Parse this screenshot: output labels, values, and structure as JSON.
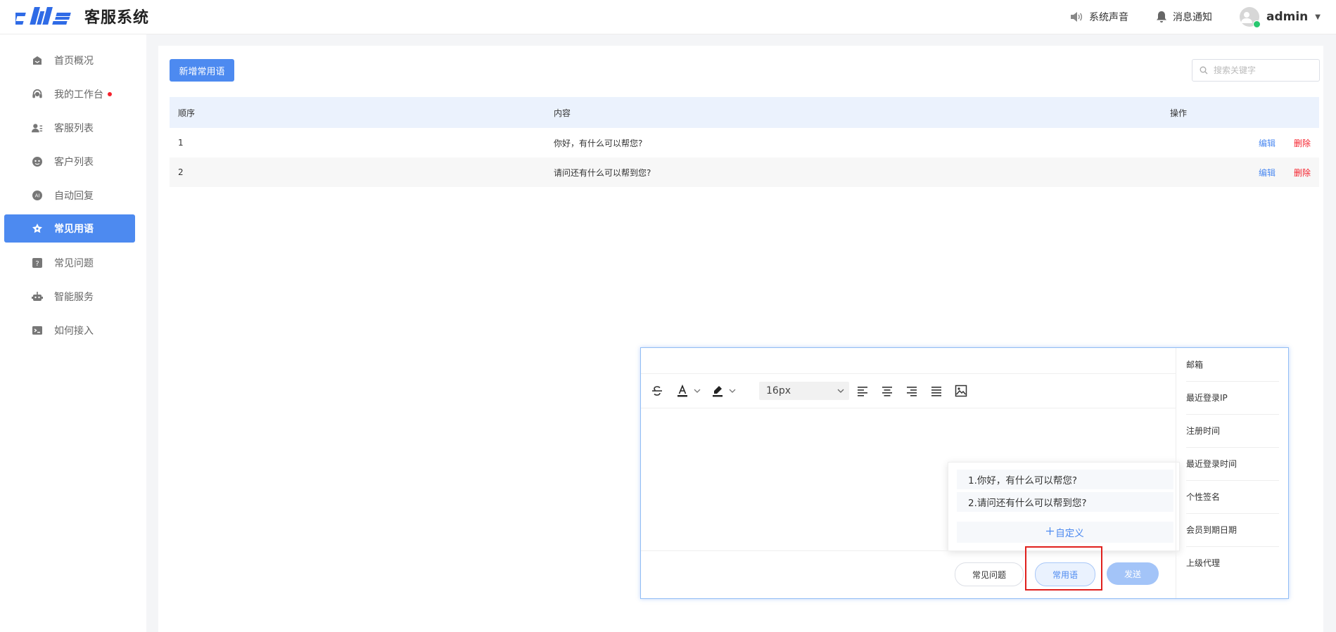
{
  "app": {
    "title": "客服系统"
  },
  "header": {
    "sound_label": "系统声音",
    "notify_label": "消息通知",
    "user_name": "admin"
  },
  "sidebar": {
    "items": [
      {
        "label": "首页概况",
        "icon": "home-icon"
      },
      {
        "label": "我的工作台",
        "icon": "headset-icon",
        "badge": "red-dot"
      },
      {
        "label": "客服列表",
        "icon": "agent-list-icon"
      },
      {
        "label": "客户列表",
        "icon": "customer-icon"
      },
      {
        "label": "自动回复",
        "icon": "auto-reply-icon"
      },
      {
        "label": "常见用语",
        "icon": "star-icon",
        "active": true
      },
      {
        "label": "常见问题",
        "icon": "question-icon"
      },
      {
        "label": "智能服务",
        "icon": "robot-icon"
      },
      {
        "label": "如何接入",
        "icon": "terminal-icon"
      }
    ]
  },
  "main": {
    "add_button": "新增常用语",
    "search_placeholder": "搜索关键字",
    "table": {
      "columns": [
        "顺序",
        "内容",
        "操作"
      ],
      "rows": [
        {
          "order": "1",
          "content": "你好，有什么可以帮您?",
          "edit": "编辑",
          "delete": "删除"
        },
        {
          "order": "2",
          "content": "请问还有什么可以帮到您?",
          "edit": "编辑",
          "delete": "删除"
        }
      ]
    }
  },
  "chat": {
    "font_size": "16px",
    "phrases": [
      "1.你好，有什么可以帮您?",
      "2.请问还有什么可以帮到您?"
    ],
    "custom_label": "自定义",
    "faq_button": "常见问题",
    "phrase_button": "常用语",
    "send_button": "发送",
    "info_fields": [
      "邮箱",
      "最近登录IP",
      "注册时间",
      "最近登录时间",
      "个性签名",
      "会员到期日期",
      "上级代理"
    ]
  },
  "colors": {
    "accent": "#4d8af0",
    "danger": "#f5222d",
    "online": "#28c76f"
  }
}
